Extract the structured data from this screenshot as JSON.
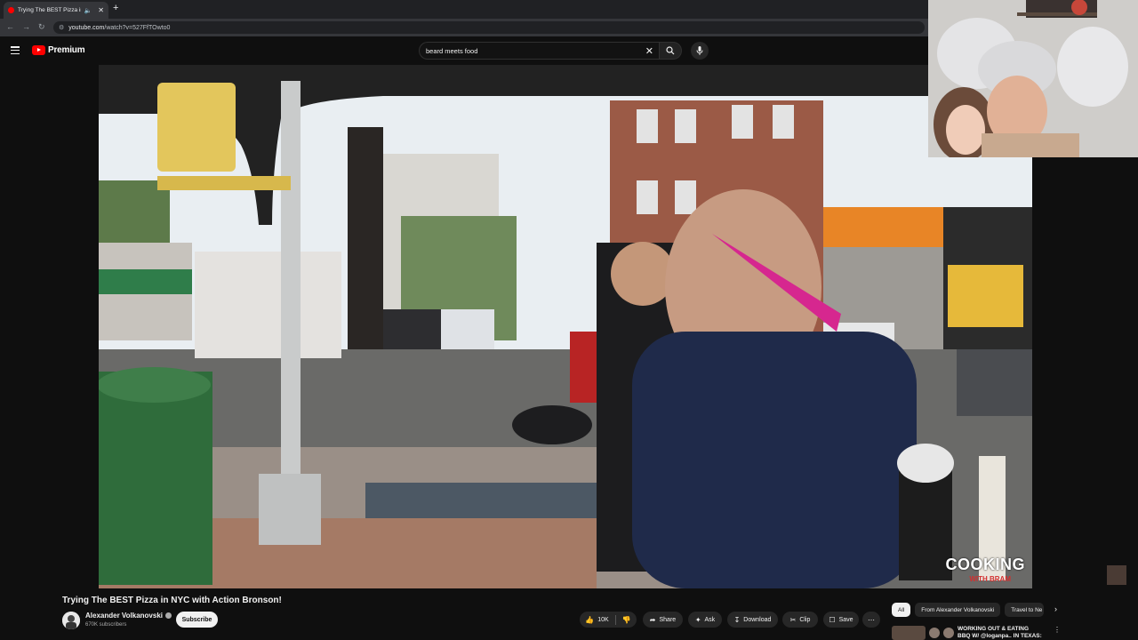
{
  "browser": {
    "tab_title": "Trying The BEST Pizza in NYC",
    "url_prefix": "youtube.com",
    "url_path": "/watch?v=527FfTOwto0"
  },
  "masthead": {
    "brand": "Premium",
    "search_value": "beard meets food"
  },
  "player": {
    "watermark": "COOKING",
    "watermark_sub": "WITH BRAM"
  },
  "video": {
    "title": "Trying The BEST Pizza in NYC with Action Bronson!",
    "channel": "Alexander Volkanovski",
    "subscribers": "670K subscribers",
    "subscribe_label": "Subscribe",
    "likes": "10K",
    "share_label": "Share",
    "ask_label": "Ask",
    "download_label": "Download",
    "clip_label": "Clip",
    "save_label": "Save"
  },
  "chips": [
    "All",
    "From Alexander Volkanovski",
    "Travel to Ne"
  ],
  "recommendation": {
    "title": "WORKING OUT & EATING BBQ W/ @loganpa.. IN TEXAS: THE"
  },
  "colors": {
    "background": "#0f0f0f",
    "brand_red": "#ff0000",
    "pill_bg": "#272727"
  }
}
